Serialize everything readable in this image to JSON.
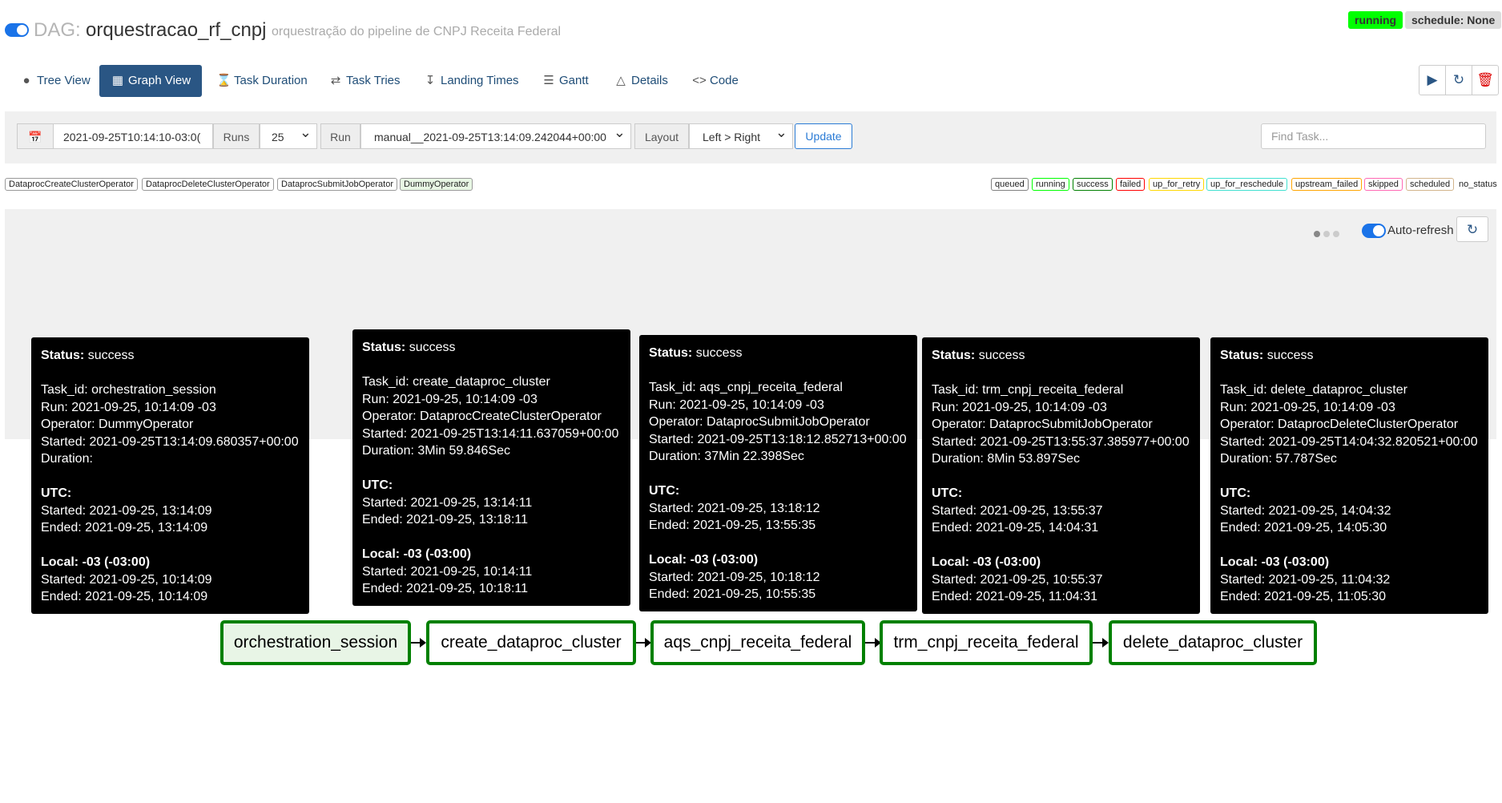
{
  "header": {
    "dag_prefix": "DAG:",
    "dag_id": "orquestracao_rf_cnpj",
    "description": "orquestração do pipeline de CNPJ Receita Federal",
    "status_badge": "running",
    "schedule_badge": "schedule: None"
  },
  "tabs": [
    {
      "label": "Tree View",
      "icon": "tree-icon"
    },
    {
      "label": "Graph View",
      "icon": "graph-icon"
    },
    {
      "label": "Task Duration",
      "icon": "hourglass-icon"
    },
    {
      "label": "Task Tries",
      "icon": "retry-icon"
    },
    {
      "label": "Landing Times",
      "icon": "landing-icon"
    },
    {
      "label": "Gantt",
      "icon": "gantt-icon"
    },
    {
      "label": "Details",
      "icon": "warning-icon"
    },
    {
      "label": "Code",
      "icon": "code-icon"
    }
  ],
  "actions": {
    "trigger_icon": "play-icon",
    "refresh_icon": "refresh-icon",
    "delete_icon": "trash-icon"
  },
  "controls": {
    "base_date": "2021-09-25T10:14:10-03:0(",
    "runs_label": "Runs",
    "runs_value": "25",
    "run_label": "Run",
    "run_value": "manual__2021-09-25T13:14:09.242044+00:00",
    "layout_label": "Layout",
    "layout_value": "Left > Right",
    "update_label": "Update",
    "find_placeholder": "Find Task..."
  },
  "operators": [
    {
      "name": "DataprocCreateClusterOperator",
      "bg": "#ffffff"
    },
    {
      "name": "DataprocDeleteClusterOperator",
      "bg": "#ffffff"
    },
    {
      "name": "DataprocSubmitJobOperator",
      "bg": "#ffffff"
    },
    {
      "name": "DummyOperator",
      "bg": "#e8f7e4"
    }
  ],
  "states": [
    {
      "name": "queued",
      "color": "#808080"
    },
    {
      "name": "running",
      "color": "#00ff00"
    },
    {
      "name": "success",
      "color": "#008000"
    },
    {
      "name": "failed",
      "color": "#ff0000"
    },
    {
      "name": "up_for_retry",
      "color": "#ffd700"
    },
    {
      "name": "up_for_reschedule",
      "color": "#40e0d0"
    },
    {
      "name": "upstream_failed",
      "color": "#ffa500"
    },
    {
      "name": "skipped",
      "color": "#ff69b4"
    },
    {
      "name": "scheduled",
      "color": "#d2b48c"
    },
    {
      "name": "no_status",
      "color": "#ffffff"
    }
  ],
  "autorefresh_label": "Auto-refresh",
  "tooltips": [
    {
      "status": "success",
      "task_id": "orchestration_session",
      "run": "2021-09-25, 10:14:09 -03",
      "operator": "DummyOperator",
      "started": "2021-09-25T13:14:09.680357+00:00",
      "duration": "",
      "utc_started": "2021-09-25, 13:14:09",
      "utc_ended": "2021-09-25, 13:14:09",
      "local_tz": "-03 (-03:00)",
      "local_started": "2021-09-25, 10:14:09",
      "local_ended": "2021-09-25, 10:14:09"
    },
    {
      "status": "success",
      "task_id": "create_dataproc_cluster",
      "run": "2021-09-25, 10:14:09 -03",
      "operator": "DataprocCreateClusterOperator",
      "started": "2021-09-25T13:14:11.637059+00:00",
      "duration": "3Min 59.846Sec",
      "utc_started": "2021-09-25, 13:14:11",
      "utc_ended": "2021-09-25, 13:18:11",
      "local_tz": "-03 (-03:00)",
      "local_started": "2021-09-25, 10:14:11",
      "local_ended": "2021-09-25, 10:18:11"
    },
    {
      "status": "success",
      "task_id": "aqs_cnpj_receita_federal",
      "run": "2021-09-25, 10:14:09 -03",
      "operator": "DataprocSubmitJobOperator",
      "started": "2021-09-25T13:18:12.852713+00:00",
      "duration": "37Min 22.398Sec",
      "utc_started": "2021-09-25, 13:18:12",
      "utc_ended": "2021-09-25, 13:55:35",
      "local_tz": "-03 (-03:00)",
      "local_started": "2021-09-25, 10:18:12",
      "local_ended": "2021-09-25, 10:55:35"
    },
    {
      "status": "success",
      "task_id": "trm_cnpj_receita_federal",
      "run": "2021-09-25, 10:14:09 -03",
      "operator": "DataprocSubmitJobOperator",
      "started": "2021-09-25T13:55:37.385977+00:00",
      "duration": "8Min 53.897Sec",
      "utc_started": "2021-09-25, 13:55:37",
      "utc_ended": "2021-09-25, 14:04:31",
      "local_tz": "-03 (-03:00)",
      "local_started": "2021-09-25, 10:55:37",
      "local_ended": "2021-09-25, 11:04:31"
    },
    {
      "status": "success",
      "task_id": "delete_dataproc_cluster",
      "run": "2021-09-25, 10:14:09 -03",
      "operator": "DataprocDeleteClusterOperator",
      "started": "2021-09-25T14:04:32.820521+00:00",
      "duration": "57.787Sec",
      "utc_started": "2021-09-25, 14:04:32",
      "utc_ended": "2021-09-25, 14:05:30",
      "local_tz": "-03 (-03:00)",
      "local_started": "2021-09-25, 11:04:32",
      "local_ended": "2021-09-25, 11:05:30"
    }
  ],
  "tooltip_labels": {
    "status": "Status:",
    "task_id": "Task_id:",
    "run": "Run:",
    "operator": "Operator:",
    "started": "Started:",
    "duration": "Duration:",
    "utc": "UTC:",
    "ended": "Ended:",
    "local": "Local:"
  },
  "nodes": [
    {
      "label": "orchestration_session"
    },
    {
      "label": "create_dataproc_cluster"
    },
    {
      "label": "aqs_cnpj_receita_federal"
    },
    {
      "label": "trm_cnpj_receita_federal"
    },
    {
      "label": "delete_dataproc_cluster"
    }
  ]
}
